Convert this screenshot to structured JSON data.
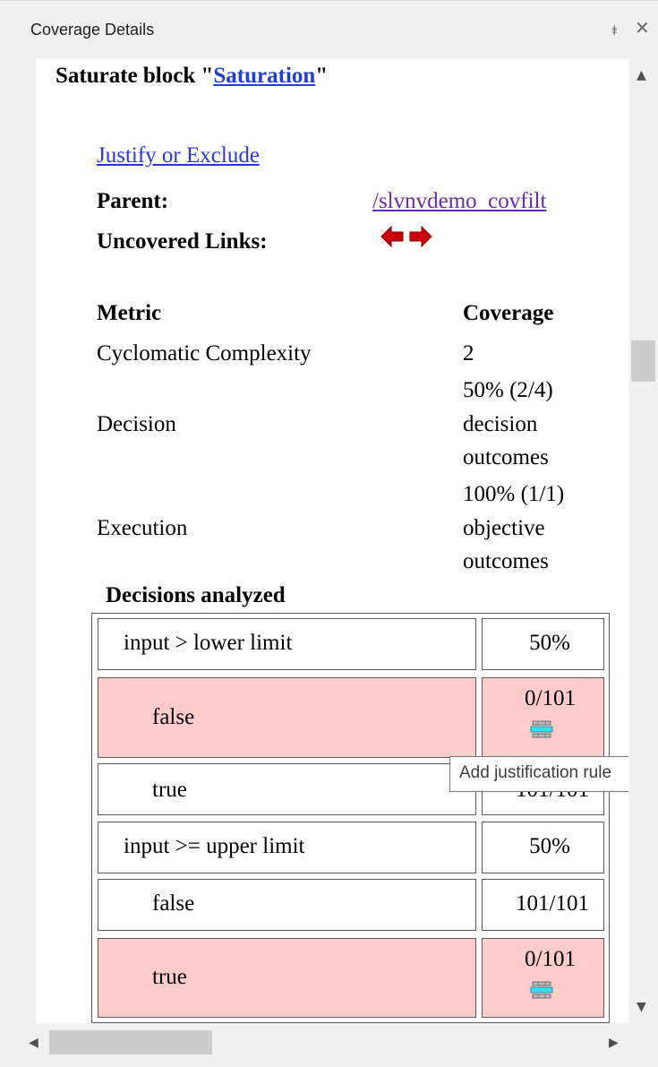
{
  "panel": {
    "title": "Coverage Details",
    "pin_glyph": "⯒",
    "close_glyph": "✕"
  },
  "header": {
    "prefix": "Saturate block \"",
    "link": "Saturation",
    "suffix": "\""
  },
  "justify_link": "Justify or Exclude",
  "parent": {
    "label": "Parent:",
    "value": "/slvnvdemo_covfilt"
  },
  "uncovered": {
    "label": "Uncovered Links:",
    "icons": [
      "arrow-left-icon",
      "arrow-right-icon"
    ]
  },
  "metrics": {
    "col_metric": "Metric",
    "col_coverage": "Coverage",
    "rows": [
      {
        "name": "Cyclomatic Complexity",
        "lines": [
          "2"
        ]
      },
      {
        "name": "Decision",
        "lines": [
          "50% (2/4)",
          "decision",
          "outcomes"
        ]
      },
      {
        "name": "Execution",
        "lines": [
          "100% (1/1)",
          "objective",
          "outcomes"
        ]
      }
    ]
  },
  "decisions": {
    "title": "Decisions analyzed",
    "rows": [
      {
        "label": "input > lower limit",
        "value": "50%",
        "uncovered": false
      },
      {
        "label": "false",
        "value": "0/101",
        "uncovered": true
      },
      {
        "label": "true",
        "value": "101/101",
        "uncovered": false
      },
      {
        "label": "input >= upper limit",
        "value": "50%",
        "uncovered": false
      },
      {
        "label": "false",
        "value": "101/101",
        "uncovered": false
      },
      {
        "label": "true",
        "value": "0/101",
        "uncovered": true
      }
    ]
  },
  "tooltip": "Add justification rule",
  "colors": {
    "uncovered": "#ffcccc",
    "link": "#2b36e8",
    "visited": "#6b2aa8",
    "arrow": "#cc0000"
  },
  "scroll": {
    "up": "▲",
    "down": "▼",
    "left": "◀",
    "right": "▶"
  }
}
